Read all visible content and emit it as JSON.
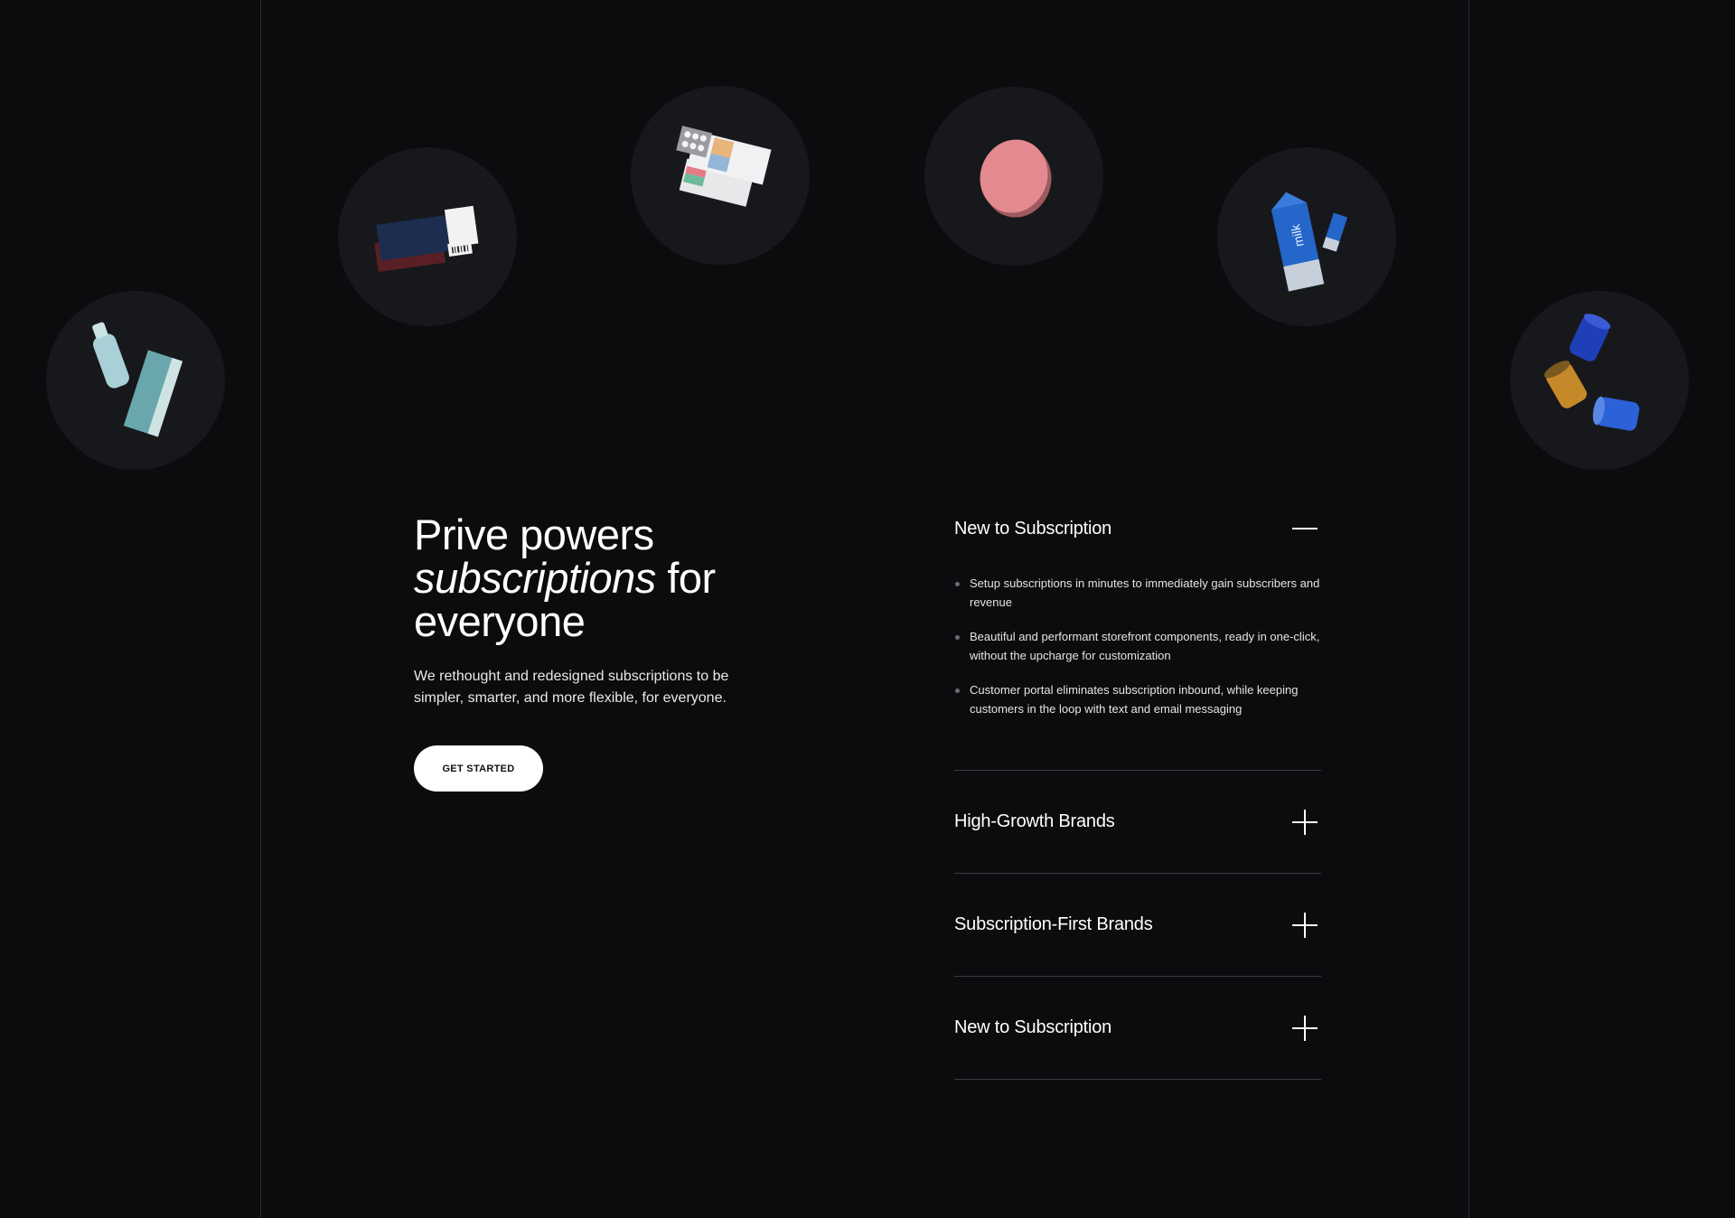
{
  "hero": {
    "title_line1": "Prive powers",
    "title_italic": "subscriptions",
    "title_after_italic": " for",
    "title_line3": "everyone",
    "description": "We rethought and redesigned subscriptions to be simpler, smarter, and more flexible, for everyone.",
    "cta_label": "GET STARTED"
  },
  "products": [
    {
      "name": "bottle-and-box-product"
    },
    {
      "name": "ticket-cards-product"
    },
    {
      "name": "pill-box-product"
    },
    {
      "name": "compact-tin-product"
    },
    {
      "name": "milk-carton-product"
    },
    {
      "name": "cans-product"
    }
  ],
  "accordion": {
    "items": [
      {
        "title": "New to Subscription",
        "state": "open",
        "bullets": [
          "Setup subscriptions in minutes to immediately gain subscribers and revenue",
          "Beautiful and performant storefront components, ready in one-click, without the upcharge for customization",
          "Customer portal eliminates subscription inbound, while keeping customers in the loop with text and email messaging"
        ]
      },
      {
        "title": "High-Growth Brands",
        "state": "closed"
      },
      {
        "title": "Subscription-First Brands",
        "state": "closed"
      },
      {
        "title": "New to Subscription",
        "state": "closed"
      }
    ]
  },
  "colors": {
    "background": "#0b0c0e",
    "circle": "#17181b",
    "divider": "#3a3c40",
    "button": "#ffffff"
  },
  "icons": {
    "open_toggle": "minus-icon",
    "closed_toggle": "plus-icon"
  }
}
